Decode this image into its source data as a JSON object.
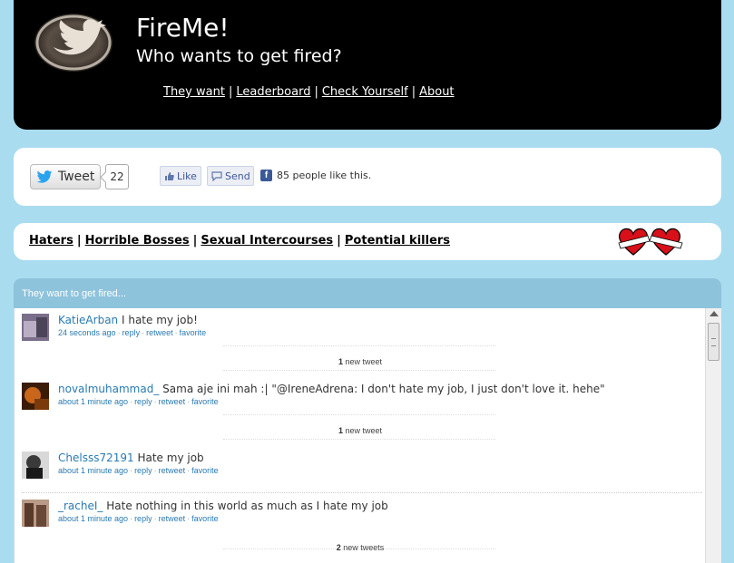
{
  "header": {
    "title": "FireMe!",
    "subtitle": "Who wants to get fired?",
    "nav": [
      "They want",
      "Leaderboard",
      "Check Yourself",
      "About"
    ],
    "separator": "|"
  },
  "social": {
    "tweet_label": "Tweet",
    "tweet_count": "22",
    "like_label": "Like",
    "send_label": "Send",
    "fb_icon": "f",
    "like_count_text": "85 people like this."
  },
  "categories": {
    "items": [
      "Haters",
      "Horrible Bosses",
      "Sexual Intercourses",
      "Potential killers"
    ]
  },
  "feed": {
    "heading": "They want to get fired...",
    "tweets": [
      {
        "user": "KatieArban",
        "text": "I hate my job!",
        "time": "24 seconds ago",
        "actions": [
          "reply",
          "retweet",
          "favorite"
        ]
      },
      {
        "user": "novalmuhammad_",
        "text": "Sama aje ini mah :| \"@IreneAdrena: I don't hate my job, I just don't love it. hehe\"",
        "time": "about 1 minute ago",
        "actions": [
          "reply",
          "retweet",
          "favorite"
        ]
      },
      {
        "user": "Chelsss72191",
        "text": "Hate my job",
        "time": "about 1 minute ago",
        "actions": [
          "reply",
          "retweet",
          "favorite"
        ]
      },
      {
        "user": "_racheI_",
        "text": "Hate nothing in this world as much as I hate my job",
        "time": "about 1 minute ago",
        "actions": [
          "reply",
          "retweet",
          "favorite"
        ]
      }
    ],
    "new_tweets": [
      {
        "count": "1",
        "label": "new tweet"
      },
      {
        "count": "1",
        "label": "new tweet"
      },
      {
        "count": "2",
        "label": "new tweets"
      }
    ],
    "meta_dot": "·"
  },
  "icons": {
    "logo": "twitter-bird-logo",
    "hearts": "love-hate-hearts"
  },
  "colors": {
    "background": "#a9dcef",
    "header": "#000000",
    "feed_head": "#8ec3dc",
    "link": "#2a7ab0"
  }
}
